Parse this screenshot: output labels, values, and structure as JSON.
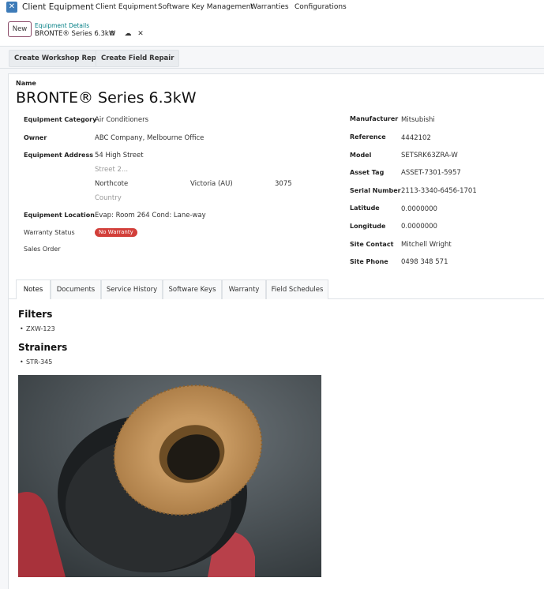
{
  "nav": {
    "app_name": "Client Equipment",
    "menu": [
      "Client Equipment",
      "Software Key Management",
      "Warranties",
      "Configurations"
    ]
  },
  "control": {
    "new_label": "New",
    "breadcrumb_parent": "Equipment Details",
    "breadcrumb_current": "BRONTE® Series 6.3kW"
  },
  "actions": {
    "workshop": "Create Workshop Repair",
    "field": "Create Field Repair"
  },
  "record": {
    "name_label": "Name",
    "name": "BRONTE® Series 6.3kW"
  },
  "left_fields": {
    "category_label": "Equipment Category",
    "category": "Air Conditioners",
    "owner_label": "Owner",
    "owner": "ABC Company, Melbourne Office",
    "address_label": "Equipment Address",
    "street": "54 High Street",
    "street2_ph": "Street 2...",
    "city": "Northcote",
    "state": "Victoria (AU)",
    "zip": "3075",
    "country_ph": "Country",
    "location_label": "Equipment Location",
    "location": "Evap: Room 264 Cond: Lane-way",
    "warranty_label": "Warranty Status",
    "warranty_badge": "No Warranty",
    "sales_label": "Sales Order"
  },
  "right_fields": [
    {
      "label": "Manufacturer",
      "value": "Mitsubishi"
    },
    {
      "label": "Reference",
      "value": "4442102"
    },
    {
      "label": "Model",
      "value": "SETSRK63ZRA-W"
    },
    {
      "label": "Asset Tag",
      "value": "ASSET-7301-5957"
    },
    {
      "label": "Serial Number",
      "value": "2113-3340-6456-1701"
    },
    {
      "label": "Latitude",
      "value": "0.0000000"
    },
    {
      "label": "Longitude",
      "value": "0.0000000"
    },
    {
      "label": "Site Contact",
      "value": "Mitchell Wright"
    },
    {
      "label": "Site Phone",
      "value": "0498 348 571"
    }
  ],
  "tabs": [
    "Notes",
    "Documents",
    "Service History",
    "Software Keys",
    "Warranty",
    "Field Schedules"
  ],
  "notes": {
    "filters_heading": "Filters",
    "filters_item": "ZXW-123",
    "strainers_heading": "Strainers",
    "strainers_item": "STR-345"
  },
  "colors": {
    "brand": "#3d7bb8",
    "accent": "#017e84",
    "danger": "#d23f3a"
  }
}
